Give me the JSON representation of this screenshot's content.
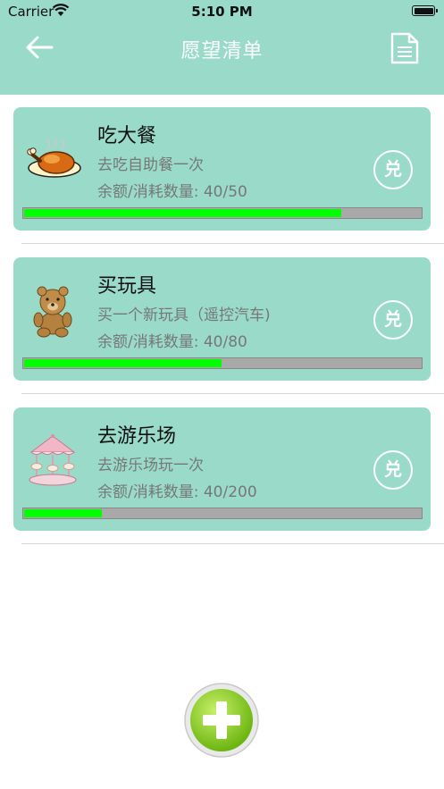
{
  "status_bar": {
    "carrier": "Carrier",
    "time": "5:10 PM"
  },
  "nav": {
    "title": "愿望清单"
  },
  "wishes": [
    {
      "icon": "roast-chicken-icon",
      "name": "吃大餐",
      "description": "去吃自助餐一次",
      "quantity_label": "余额/消耗数量: 40/50",
      "redeem_label": "兑",
      "progress": 0.8
    },
    {
      "icon": "teddy-bear-icon",
      "name": "买玩具",
      "description": "买一个新玩具（遥控汽车)",
      "quantity_label": "余额/消耗数量: 40/80",
      "redeem_label": "兑",
      "progress": 0.5
    },
    {
      "icon": "carousel-icon",
      "name": "去游乐场",
      "description": "去游乐场玩一次",
      "quantity_label": "余额/消耗数量: 40/200",
      "redeem_label": "兑",
      "progress": 0.2
    }
  ],
  "colors": {
    "theme": "#99dbc8",
    "progress_fill": "#00ff00",
    "progress_track": "#a9a9a9",
    "add_button": "#7ed321"
  }
}
